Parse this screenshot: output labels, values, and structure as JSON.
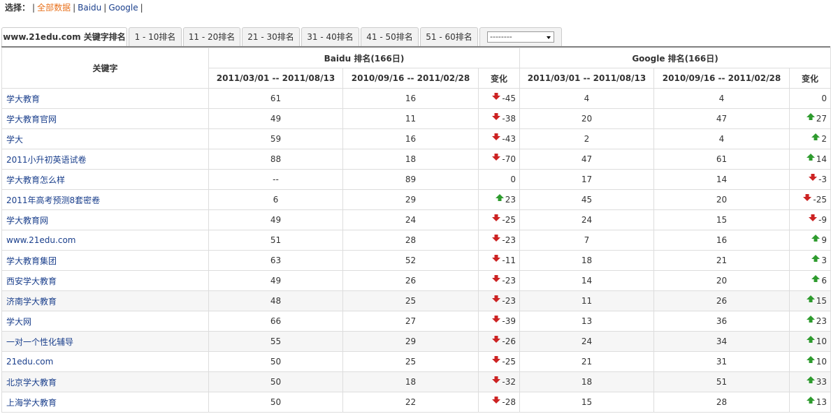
{
  "filter": {
    "label": "选择：",
    "items": [
      {
        "label": "全部数据",
        "active": true
      },
      {
        "label": "Baidu",
        "active": false
      },
      {
        "label": "Google",
        "active": false
      }
    ]
  },
  "tabs": [
    {
      "label": "www.21edu.com 关键字排名",
      "active": true
    },
    {
      "label": "1 - 10排名"
    },
    {
      "label": "11 - 20排名"
    },
    {
      "label": "21 - 30排名"
    },
    {
      "label": "31 - 40排名"
    },
    {
      "label": "41 - 50排名"
    },
    {
      "label": "51 - 60排名"
    }
  ],
  "select": {
    "value": "--------"
  },
  "table": {
    "keyword_header": "关键字",
    "baidu_header": "Baidu 排名(166日)",
    "google_header": "Google 排名(166日)",
    "period1": "2011/03/01 -- 2011/08/13",
    "period2": "2010/09/16 -- 2011/02/28",
    "change": "变化",
    "colors": {
      "up": "#2e9b2e",
      "down": "#cc2222"
    },
    "rows": [
      {
        "kw": "学大教育",
        "b1": "61",
        "b2": "16",
        "bc": "-45",
        "bdir": "down",
        "g1": "4",
        "g2": "4",
        "gc": "0",
        "gdir": "none"
      },
      {
        "kw": "学大教育官网",
        "b1": "49",
        "b2": "11",
        "bc": "-38",
        "bdir": "down",
        "g1": "20",
        "g2": "47",
        "gc": "27",
        "gdir": "up"
      },
      {
        "kw": "学大",
        "b1": "59",
        "b2": "16",
        "bc": "-43",
        "bdir": "down",
        "g1": "2",
        "g2": "4",
        "gc": "2",
        "gdir": "up"
      },
      {
        "kw": "2011小升初英语试卷",
        "b1": "88",
        "b2": "18",
        "bc": "-70",
        "bdir": "down",
        "g1": "47",
        "g2": "61",
        "gc": "14",
        "gdir": "up"
      },
      {
        "kw": "学大教育怎么样",
        "b1": "--",
        "b2": "89",
        "bc": "0",
        "bdir": "none",
        "g1": "17",
        "g2": "14",
        "gc": "-3",
        "gdir": "down"
      },
      {
        "kw": "2011年高考预测8套密卷",
        "b1": "6",
        "b2": "29",
        "bc": "23",
        "bdir": "up",
        "g1": "45",
        "g2": "20",
        "gc": "-25",
        "gdir": "down"
      },
      {
        "kw": "学大教育网",
        "b1": "49",
        "b2": "24",
        "bc": "-25",
        "bdir": "down",
        "g1": "24",
        "g2": "15",
        "gc": "-9",
        "gdir": "down"
      },
      {
        "kw": "www.21edu.com",
        "b1": "51",
        "b2": "28",
        "bc": "-23",
        "bdir": "down",
        "g1": "7",
        "g2": "16",
        "gc": "9",
        "gdir": "up"
      },
      {
        "kw": "学大教育集团",
        "b1": "63",
        "b2": "52",
        "bc": "-11",
        "bdir": "down",
        "g1": "18",
        "g2": "21",
        "gc": "3",
        "gdir": "up"
      },
      {
        "kw": "西安学大教育",
        "b1": "49",
        "b2": "26",
        "bc": "-23",
        "bdir": "down",
        "g1": "14",
        "g2": "20",
        "gc": "6",
        "gdir": "up"
      },
      {
        "kw": "济南学大教育",
        "b1": "48",
        "b2": "25",
        "bc": "-23",
        "bdir": "down",
        "g1": "11",
        "g2": "26",
        "gc": "15",
        "gdir": "up"
      },
      {
        "kw": "学大网",
        "b1": "66",
        "b2": "27",
        "bc": "-39",
        "bdir": "down",
        "g1": "13",
        "g2": "36",
        "gc": "23",
        "gdir": "up"
      },
      {
        "kw": "一对一个性化辅导",
        "b1": "55",
        "b2": "29",
        "bc": "-26",
        "bdir": "down",
        "g1": "24",
        "g2": "34",
        "gc": "10",
        "gdir": "up"
      },
      {
        "kw": "21edu.com",
        "b1": "50",
        "b2": "25",
        "bc": "-25",
        "bdir": "down",
        "g1": "21",
        "g2": "31",
        "gc": "10",
        "gdir": "up"
      },
      {
        "kw": "北京学大教育",
        "b1": "50",
        "b2": "18",
        "bc": "-32",
        "bdir": "down",
        "g1": "18",
        "g2": "51",
        "gc": "33",
        "gdir": "up"
      },
      {
        "kw": "上海学大教育",
        "b1": "50",
        "b2": "22",
        "bc": "-28",
        "bdir": "down",
        "g1": "15",
        "g2": "28",
        "gc": "13",
        "gdir": "up"
      }
    ]
  }
}
